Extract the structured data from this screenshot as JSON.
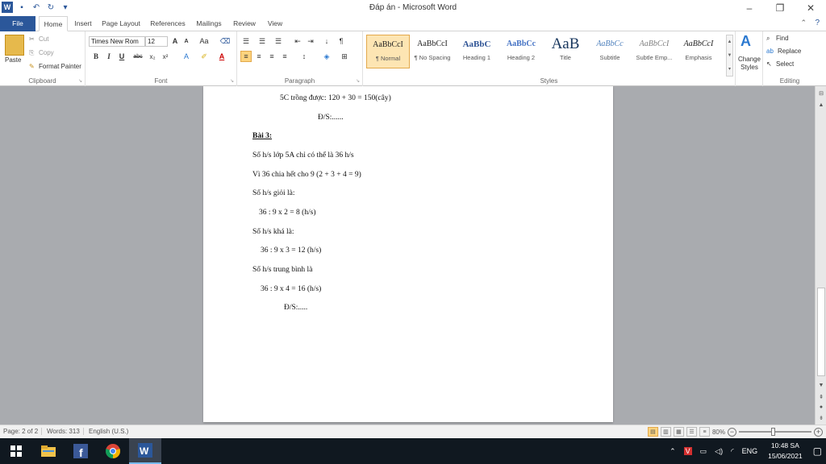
{
  "window": {
    "title": "Đáp án - Microsoft Word"
  },
  "tabs": [
    "File",
    "Home",
    "Insert",
    "Page Layout",
    "References",
    "Mailings",
    "Review",
    "View"
  ],
  "clipboard": {
    "paste": "Paste",
    "cut": "Cut",
    "copy": "Copy",
    "format_painter": "Format Painter",
    "label": "Clipboard"
  },
  "font": {
    "name": "Times New Rom",
    "size": "12",
    "label": "Font"
  },
  "paragraph": {
    "label": "Paragraph"
  },
  "styles": {
    "label": "Styles",
    "items": [
      {
        "sample": "AaBbCcI",
        "name": "¶ Normal"
      },
      {
        "sample": "AaBbCcI",
        "name": "¶ No Spacing"
      },
      {
        "sample": "AaBbC",
        "name": "Heading 1"
      },
      {
        "sample": "AaBbCc",
        "name": "Heading 2"
      },
      {
        "sample": "AaB",
        "name": "Title"
      },
      {
        "sample": "AaBbCc",
        "name": "Subtitle"
      },
      {
        "sample": "AaBbCcI",
        "name": "Subtle Emp..."
      },
      {
        "sample": "AaBbCcI",
        "name": "Emphasis"
      }
    ],
    "change_styles": "Change Styles"
  },
  "editing": {
    "find": "Find",
    "replace": "Replace",
    "select": "Select",
    "label": "Editing"
  },
  "document": {
    "lines": [
      "5C trồng được: 120 + 30 = 150(cây)",
      "Đ/S:......",
      "Bài 3:",
      "Số h/s lớp 5A chỉ có thể là 36 h/s",
      "Vì 36 chia hết cho 9 (2 + 3 + 4 = 9)",
      "Số h/s giỏi là:",
      "36 : 9 x 2 = 8 (h/s)",
      "Số h/s khá là:",
      "36 : 9 x 3 = 12 (h/s)",
      "Số h/s trung bình là",
      "36 : 9 x 4 = 16 (h/s)",
      "Đ/S:....."
    ]
  },
  "status": {
    "page": "Page: 2 of 2",
    "words": "Words: 313",
    "language": "English (U.S.)",
    "zoom": "80%"
  },
  "taskbar": {
    "tray_lang": "ENG",
    "time": "10:48 SA",
    "date": "15/06/2021"
  }
}
